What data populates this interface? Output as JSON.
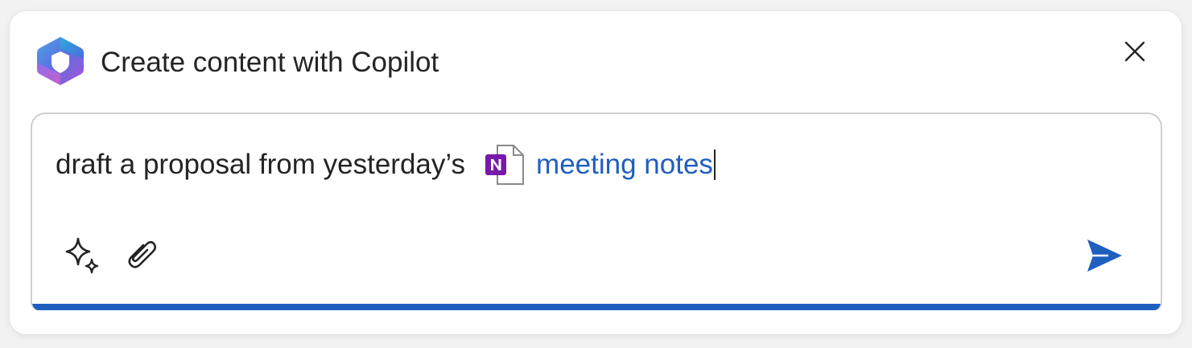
{
  "dialog": {
    "title": "Create content with Copilot"
  },
  "composer": {
    "prompt_text": "draft a proposal from yesterday’s",
    "reference_label": "meeting notes",
    "reference_app_icon": "onenote-icon"
  },
  "toolbar": {
    "icons": [
      "sparkle-icon",
      "paperclip-icon"
    ],
    "send_icon": "send-icon"
  },
  "colors": {
    "accent": "#1f5fbf",
    "onenote_purple": "#7719aa",
    "text": "#242424",
    "border": "#cfcfcf"
  }
}
